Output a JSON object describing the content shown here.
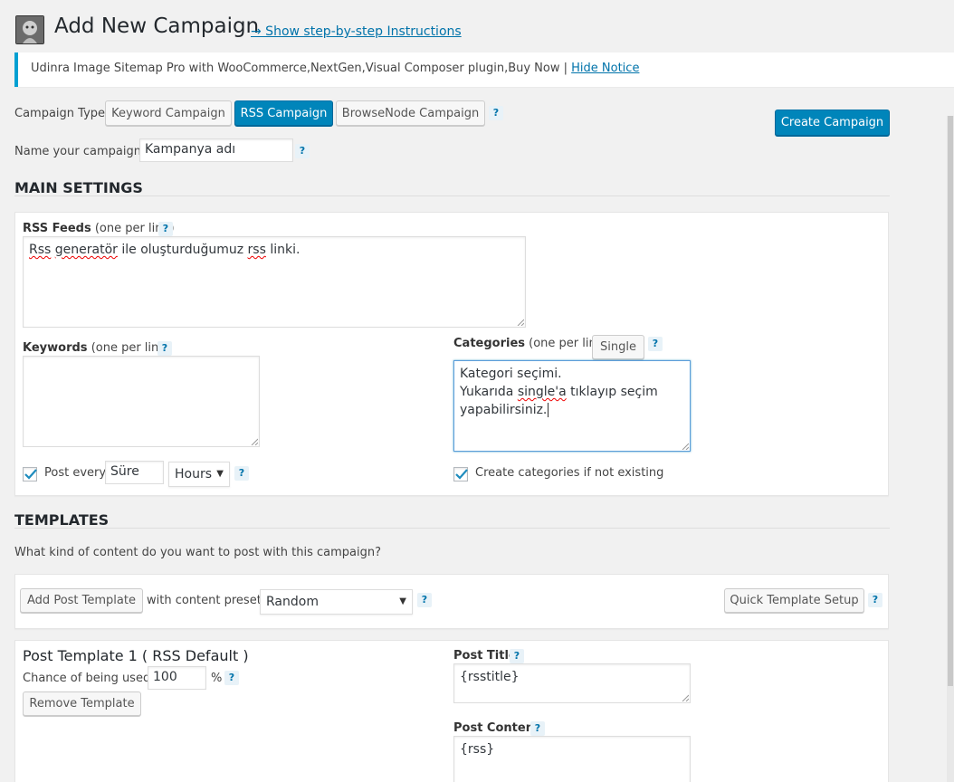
{
  "header": {
    "title": "Add New Campaign",
    "instructions_link": "→ Show step-by-step Instructions"
  },
  "notice": {
    "text": "Udinra Image Sitemap Pro with WooCommerce,NextGen,Visual Composer plugin,Buy Now | ",
    "hide_link": "Hide Notice"
  },
  "campaign_type": {
    "label": "Campaign Type:",
    "options": [
      "Keyword Campaign",
      "RSS Campaign",
      "BrowseNode Campaign"
    ],
    "selected": "RSS Campaign"
  },
  "help_mark": "?",
  "create_button": "Create Campaign",
  "name": {
    "label": "Name your campaign:",
    "value": "Kampanya adı"
  },
  "main_settings": {
    "heading": "MAIN SETTINGS",
    "rss_feeds": {
      "label": "RSS Feeds",
      "hint": "(one per line)",
      "value_parts": [
        "Rss",
        " ",
        "generatör",
        " ile oluşturduğumuz ",
        "rss",
        " linki."
      ]
    },
    "keywords": {
      "label": "Keywords",
      "hint": "(one per line)",
      "value": ""
    },
    "categories": {
      "label": "Categories",
      "hint": "(one per line)",
      "single_button": "Single",
      "line1": "Kategori seçimi.",
      "line2_a": "Yukarıda ",
      "line2_b": "single'a",
      "line2_c": " tıklayıp seçim",
      "line3": "yapabilirsiniz."
    },
    "post_every": {
      "label": "Post every",
      "value": "Süre",
      "unit": "Hours",
      "checked": true
    },
    "create_categories": {
      "label": "Create categories if not existing",
      "checked": true
    }
  },
  "templates": {
    "heading": "TEMPLATES",
    "question": "What kind of content do you want to post with this campaign?",
    "add_button": "Add Post Template",
    "preset_label": "with content preset:",
    "preset_value": "Random",
    "quick_setup_button": "Quick Template Setup",
    "post_template": {
      "title": "Post Template 1 ( RSS Default )",
      "chance_label": "Chance of being used:",
      "chance_value": "100",
      "percent": "%",
      "remove_button": "Remove Template",
      "post_title_label": "Post Title",
      "post_title_value": "{rsstitle}",
      "post_content_label": "Post Content",
      "post_content_value": "{rss}"
    }
  }
}
